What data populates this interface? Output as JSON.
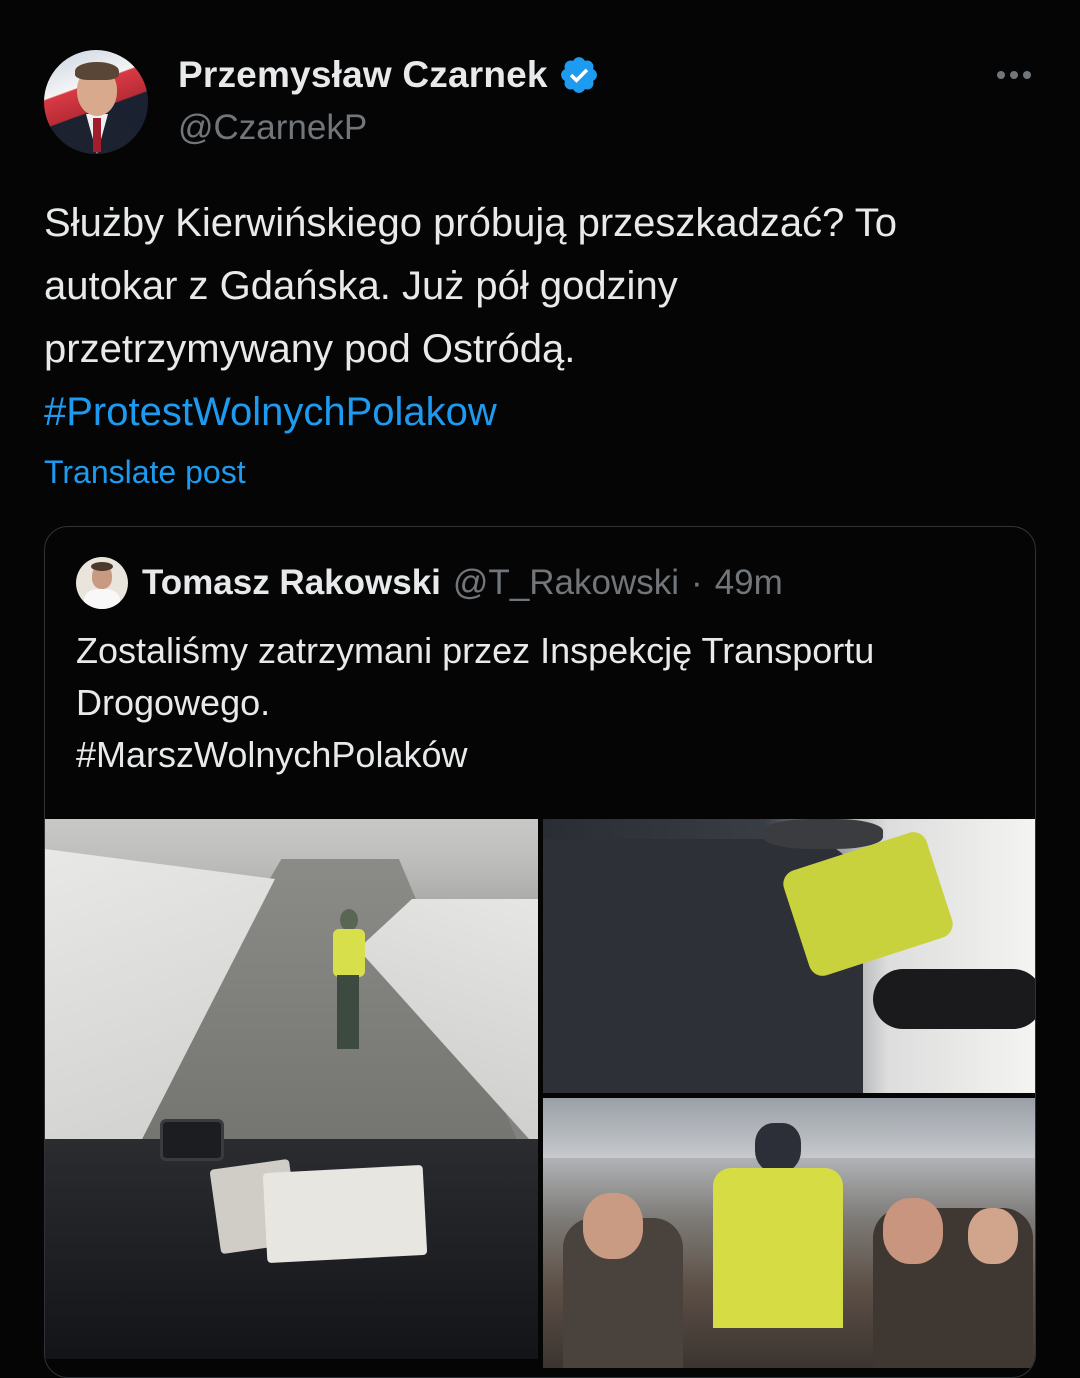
{
  "author": {
    "name": "Przemysław Czarnek",
    "handle": "@CzarnekP",
    "verified_icon": "verified-badge-icon",
    "badge_color": "#1d9bf0"
  },
  "post": {
    "lines": [
      "Służby Kierwińskiego próbują przeszkadzać? To",
      "autokar z Gdańska. Już pół godziny",
      "przetrzymywany pod Ostródą."
    ],
    "hashtag": "#ProtestWolnychPolakow",
    "translate_label": "Translate post"
  },
  "quoted": {
    "name": "Tomasz Rakowski",
    "handle": "@T_Rakowski",
    "separator": "·",
    "time": "49m",
    "lines": [
      "Zostaliśmy zatrzymani przez Inspekcję Transportu",
      "Drogowego.",
      "#MarszWolnychPolaków"
    ]
  },
  "colors": {
    "background": "#050505",
    "text": "#e7e9ea",
    "secondary": "#71767b",
    "link": "#1d9bf0",
    "border": "#2f3336"
  }
}
